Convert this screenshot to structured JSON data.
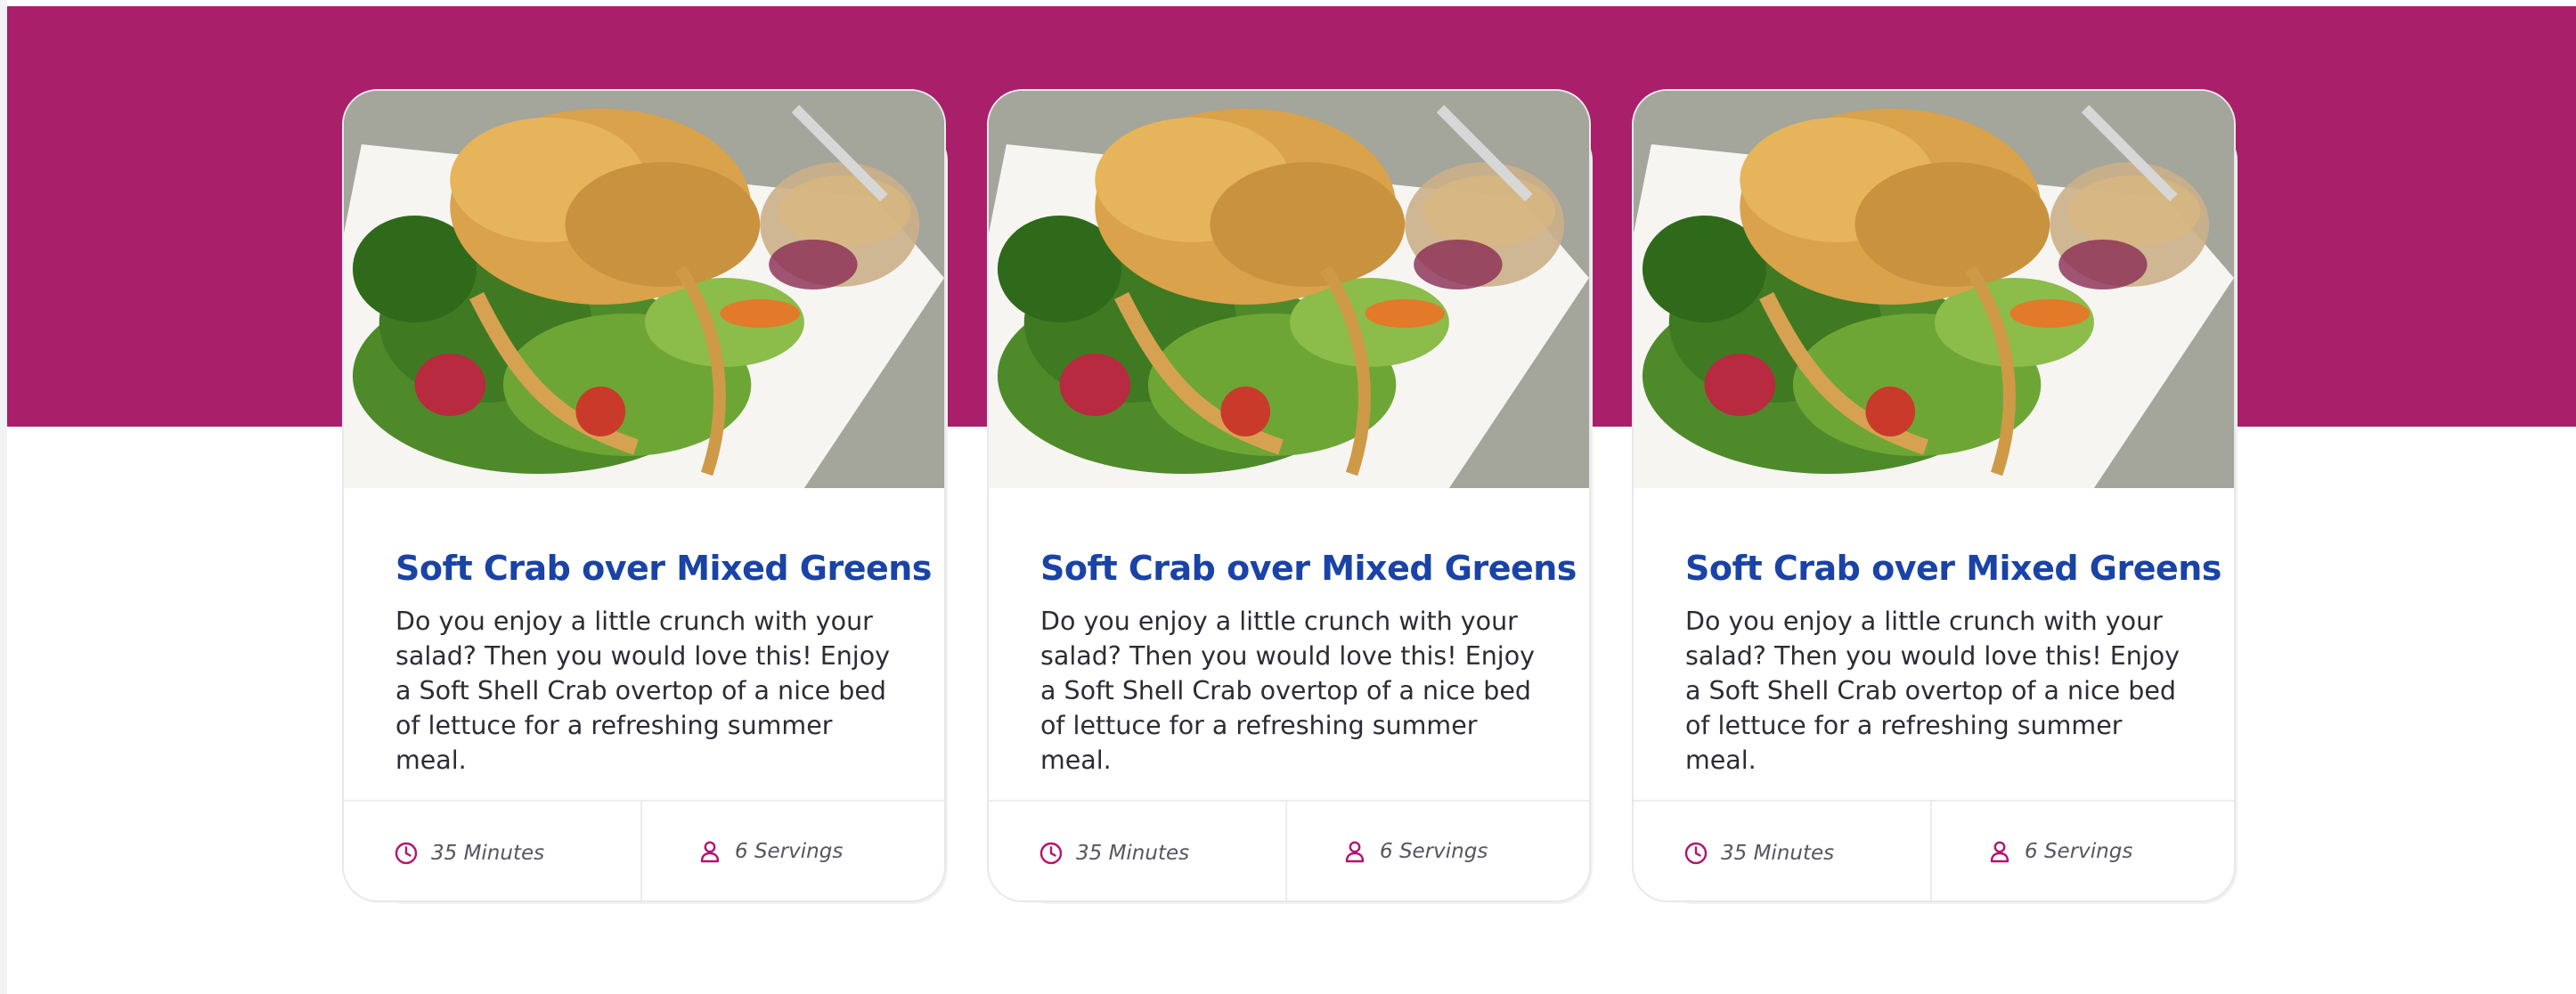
{
  "colors": {
    "hero_band": "#a91f6a",
    "title": "#1a43a7",
    "body_text": "#2c2c34",
    "meta_text": "#56565e",
    "icon_accent": "#b3126f"
  },
  "cards": [
    {
      "title": "Soft Crab over Mixed Greens",
      "description": "Do you enjoy a little crunch with your salad? Then you would love this! Enjoy a Soft Shell Crab overtop of a nice bed of lettuce for a refreshing summer meal.",
      "time": "35 Minutes",
      "servings": "6 Servings",
      "time_icon": "clock-icon",
      "servings_icon": "person-icon"
    },
    {
      "title": "Soft Crab over Mixed Greens",
      "description": "Do you enjoy a little crunch with your salad? Then you would love this! Enjoy a Soft Shell Crab overtop of a nice bed of lettuce for a refreshing summer meal.",
      "time": "35 Minutes",
      "servings": "6 Servings",
      "time_icon": "clock-icon",
      "servings_icon": "person-icon"
    },
    {
      "title": "Soft Crab over Mixed Greens",
      "description": "Do you enjoy a little crunch with your salad? Then you would love this! Enjoy a Soft Shell Crab overtop of a nice bed of lettuce for a refreshing summer meal.",
      "time": "35 Minutes",
      "servings": "6 Servings",
      "time_icon": "clock-icon",
      "servings_icon": "person-icon"
    }
  ]
}
